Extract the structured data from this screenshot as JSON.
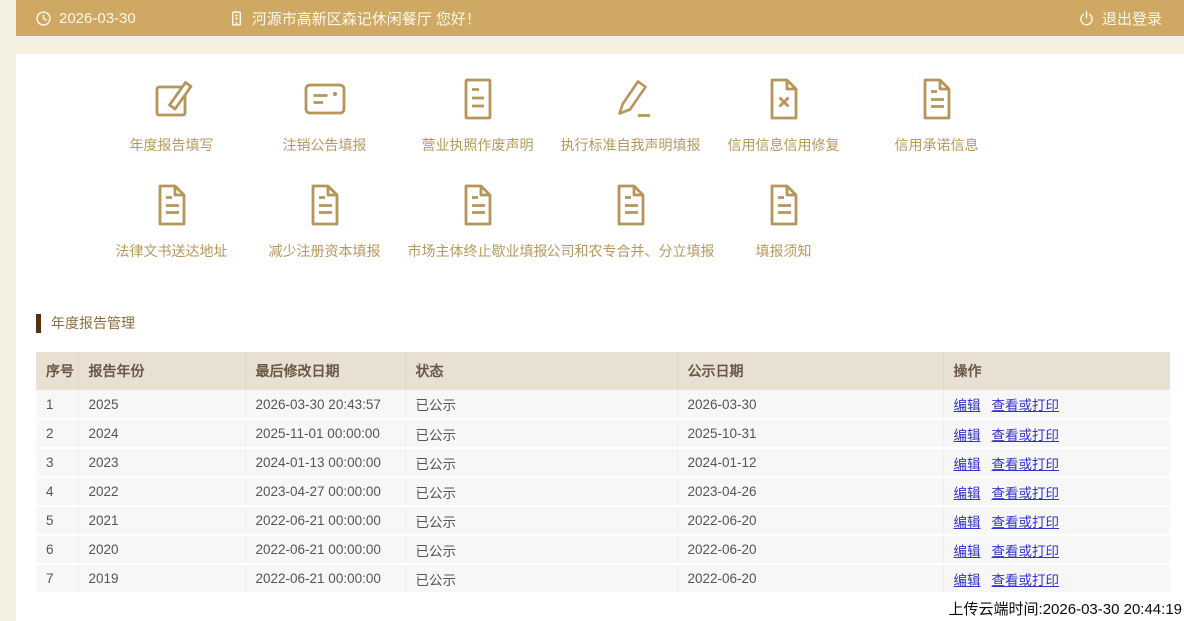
{
  "topbar": {
    "date": "2026-03-30",
    "greeting": "河源市高新区森记休闲餐厅 您好！",
    "logout_label": "退出登录"
  },
  "nav": {
    "items": [
      {
        "label": "年度报告填写",
        "icon": "edit-square-icon"
      },
      {
        "label": "注销公告填报",
        "icon": "card-note-icon"
      },
      {
        "label": "营业执照作废声明",
        "icon": "doc-lines-icon"
      },
      {
        "label": "执行标准自我声明填报",
        "icon": "pencil-sign-icon"
      },
      {
        "label": "信用信息信用修复",
        "icon": "doc-x-icon"
      },
      {
        "label": "信用承诺信息",
        "icon": "doc-text-icon"
      },
      {
        "label": "法律文书送达地址",
        "icon": "doc-text-icon"
      },
      {
        "label": "减少注册资本填报",
        "icon": "doc-text-icon"
      },
      {
        "label": "市场主体终止歇业填报",
        "icon": "doc-text-icon"
      },
      {
        "label": "公司和农专合并、分立填报",
        "icon": "doc-text-icon"
      },
      {
        "label": "填报须知",
        "icon": "doc-text-icon"
      }
    ]
  },
  "section": {
    "title": "年度报告管理"
  },
  "table": {
    "headers": [
      "序号",
      "报告年份",
      "最后修改日期",
      "状态",
      "公示日期",
      "操作"
    ],
    "actions": {
      "edit": "编辑",
      "view": "查看或打印"
    },
    "rows": [
      {
        "no": "1",
        "year": "2025",
        "modified": "2026-03-30 20:43:57",
        "status": "已公示",
        "published": "2026-03-30"
      },
      {
        "no": "2",
        "year": "2024",
        "modified": "2025-11-01 00:00:00",
        "status": "已公示",
        "published": "2025-10-31"
      },
      {
        "no": "3",
        "year": "2023",
        "modified": "2024-01-13 00:00:00",
        "status": "已公示",
        "published": "2024-01-12"
      },
      {
        "no": "4",
        "year": "2022",
        "modified": "2023-04-27 00:00:00",
        "status": "已公示",
        "published": "2023-04-26"
      },
      {
        "no": "5",
        "year": "2021",
        "modified": "2022-06-21 00:00:00",
        "status": "已公示",
        "published": "2022-06-20"
      },
      {
        "no": "6",
        "year": "2020",
        "modified": "2022-06-21 00:00:00",
        "status": "已公示",
        "published": "2022-06-20"
      },
      {
        "no": "7",
        "year": "2019",
        "modified": "2022-06-21 00:00:00",
        "status": "已公示",
        "published": "2022-06-20"
      }
    ]
  },
  "footer": {
    "upload_time": "上传云端时间:2026-03-30 20:44:19"
  },
  "colors": {
    "topbar_gold": "#cfa963",
    "icon_gold": "#b6955a",
    "section_bar_brown": "#54300e",
    "link_blue": "#3333cc",
    "header_beige": "#e7e0d3"
  }
}
